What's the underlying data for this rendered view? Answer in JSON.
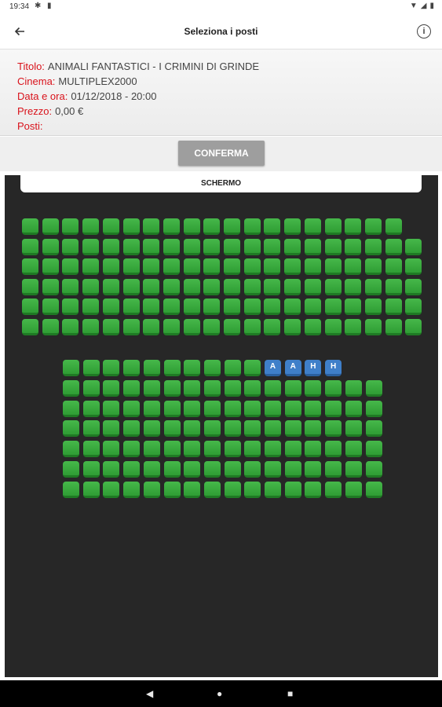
{
  "status_bar": {
    "time": "19:34"
  },
  "app_bar": {
    "title": "Seleziona i posti"
  },
  "details": [
    {
      "label": "Titolo:",
      "value": "ANIMALI FANTASTICI - I CRIMINI DI GRINDE"
    },
    {
      "label": "Cinema:",
      "value": "MULTIPLEX2000"
    },
    {
      "label": "Data e ora:",
      "value": "01/12/2018 - 20:00"
    },
    {
      "label": "Prezzo:",
      "value": "0,00 €"
    },
    {
      "label": "Posti:",
      "value": ""
    }
  ],
  "confirm_label": "CONFERMA",
  "screen_label": "SCHERMO",
  "colors": {
    "accent_red": "#d9121b",
    "seat_free": "#3aab3f",
    "seat_selected": "#3f7fc9",
    "hall_bg": "#272727"
  },
  "seating": {
    "upper_block": [
      {
        "row": 1,
        "seats": 19
      },
      {
        "row": 2,
        "seats": 20
      },
      {
        "row": 3,
        "seats": 20
      },
      {
        "row": 4,
        "seats": 20
      },
      {
        "row": 5,
        "seats": 20
      },
      {
        "row": 6,
        "seats": 20
      }
    ],
    "lower_block": [
      {
        "row": 1,
        "seats": 10,
        "marked": [
          "A",
          "A",
          "H",
          "H"
        ]
      },
      {
        "row": 2,
        "seats": 16
      },
      {
        "row": 3,
        "seats": 16
      },
      {
        "row": 4,
        "seats": 16
      },
      {
        "row": 5,
        "seats": 16
      },
      {
        "row": 6,
        "seats": 16
      },
      {
        "row": 7,
        "seats": 16
      }
    ]
  }
}
